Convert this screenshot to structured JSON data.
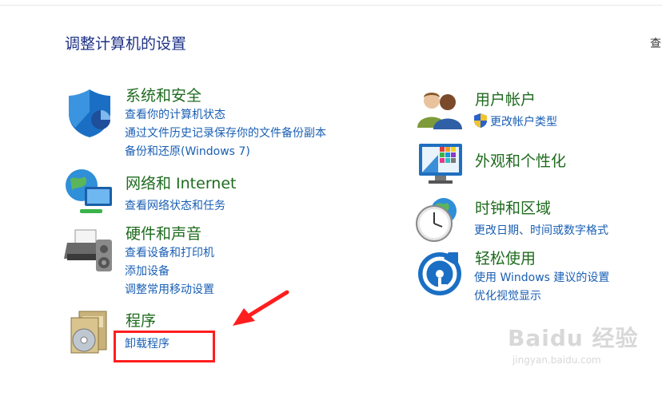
{
  "page_title": "调整计算机的设置",
  "view_by_partial": "查",
  "left_categories": [
    {
      "title": "系统和安全",
      "icon": "shield-icon",
      "links": [
        "查看你的计算机状态",
        "通过文件历史记录保存你的文件备份副本",
        "备份和还原(Windows 7)"
      ]
    },
    {
      "title": "网络和 Internet",
      "icon": "network-globe-icon",
      "links": [
        "查看网络状态和任务"
      ]
    },
    {
      "title": "硬件和声音",
      "icon": "printer-speaker-icon",
      "links": [
        "查看设备和打印机",
        "添加设备",
        "调整常用移动设置"
      ]
    },
    {
      "title": "程序",
      "icon": "programs-disc-icon",
      "links": [
        "卸载程序"
      ]
    }
  ],
  "right_categories": [
    {
      "title": "用户帐户",
      "icon": "users-icon",
      "links": [
        "更改帐户类型"
      ]
    },
    {
      "title": "外观和个性化",
      "icon": "monitor-color-icon",
      "links": []
    },
    {
      "title": "时钟和区域",
      "icon": "clock-globe-icon",
      "links": [
        "更改日期、时间或数字格式"
      ]
    },
    {
      "title": "轻松使用",
      "icon": "ease-of-access-icon",
      "links": [
        "使用 Windows 建议的设置",
        "优化视觉显示"
      ]
    }
  ],
  "watermark": {
    "main": "Baidu 经验",
    "sub": "jingyan.baidu.com"
  },
  "colors": {
    "title": "#1e3287",
    "category": "#1e6b1e",
    "link": "#1a5fb4",
    "annotation": "#ff1e1e"
  }
}
